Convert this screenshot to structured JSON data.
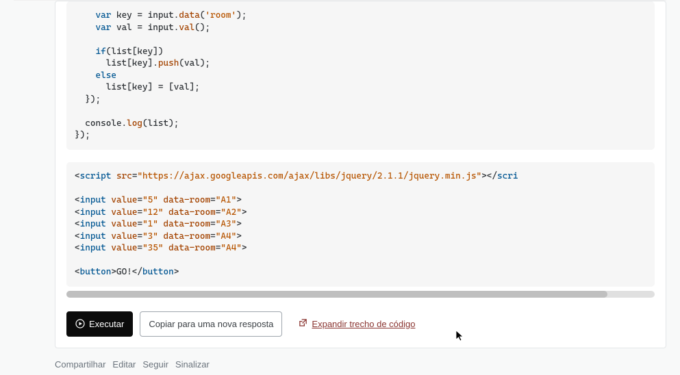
{
  "codeA": {
    "lines": [
      [
        {
          "c": "pun",
          "t": "    "
        },
        {
          "c": "kw",
          "t": "var"
        },
        {
          "c": "pun",
          "t": " key = input."
        },
        {
          "c": "fn",
          "t": "data"
        },
        {
          "c": "pun",
          "t": "("
        },
        {
          "c": "str",
          "t": "'room'"
        },
        {
          "c": "pun",
          "t": ");"
        }
      ],
      [
        {
          "c": "pun",
          "t": "    "
        },
        {
          "c": "kw",
          "t": "var"
        },
        {
          "c": "pun",
          "t": " val = input."
        },
        {
          "c": "fn",
          "t": "val"
        },
        {
          "c": "pun",
          "t": "();"
        }
      ],
      [],
      [
        {
          "c": "pun",
          "t": "    "
        },
        {
          "c": "kw",
          "t": "if"
        },
        {
          "c": "pun",
          "t": "(list[key])"
        }
      ],
      [
        {
          "c": "pun",
          "t": "      list[key]."
        },
        {
          "c": "fn",
          "t": "push"
        },
        {
          "c": "pun",
          "t": "(val);"
        }
      ],
      [
        {
          "c": "pun",
          "t": "    "
        },
        {
          "c": "kw",
          "t": "else"
        }
      ],
      [
        {
          "c": "pun",
          "t": "      list[key] = [val];"
        }
      ],
      [
        {
          "c": "pun",
          "t": "  });"
        }
      ],
      [],
      [
        {
          "c": "pun",
          "t": "  console."
        },
        {
          "c": "fn",
          "t": "log"
        },
        {
          "c": "pun",
          "t": "(list);"
        }
      ],
      [
        {
          "c": "pun",
          "t": "});"
        }
      ]
    ]
  },
  "codeB": {
    "lines": [
      [
        {
          "c": "pun",
          "t": "<"
        },
        {
          "c": "kw",
          "t": "script"
        },
        {
          "c": "pun",
          "t": " "
        },
        {
          "c": "fn",
          "t": "src"
        },
        {
          "c": "pun",
          "t": "="
        },
        {
          "c": "str",
          "t": "\"https://ajax.googleapis.com/ajax/libs/jquery/2.1.1/jquery.min.js\""
        },
        {
          "c": "pun",
          "t": "></"
        },
        {
          "c": "kw",
          "t": "scri"
        }
      ],
      [],
      [
        {
          "c": "pun",
          "t": "<"
        },
        {
          "c": "kw",
          "t": "input"
        },
        {
          "c": "pun",
          "t": " "
        },
        {
          "c": "fn",
          "t": "value"
        },
        {
          "c": "pun",
          "t": "="
        },
        {
          "c": "str",
          "t": "\"5\""
        },
        {
          "c": "pun",
          "t": " "
        },
        {
          "c": "fn",
          "t": "data-room"
        },
        {
          "c": "pun",
          "t": "="
        },
        {
          "c": "str",
          "t": "\"A1\""
        },
        {
          "c": "pun",
          "t": ">"
        }
      ],
      [
        {
          "c": "pun",
          "t": "<"
        },
        {
          "c": "kw",
          "t": "input"
        },
        {
          "c": "pun",
          "t": " "
        },
        {
          "c": "fn",
          "t": "value"
        },
        {
          "c": "pun",
          "t": "="
        },
        {
          "c": "str",
          "t": "\"12\""
        },
        {
          "c": "pun",
          "t": " "
        },
        {
          "c": "fn",
          "t": "data-room"
        },
        {
          "c": "pun",
          "t": "="
        },
        {
          "c": "str",
          "t": "\"A2\""
        },
        {
          "c": "pun",
          "t": ">"
        }
      ],
      [
        {
          "c": "pun",
          "t": "<"
        },
        {
          "c": "kw",
          "t": "input"
        },
        {
          "c": "pun",
          "t": " "
        },
        {
          "c": "fn",
          "t": "value"
        },
        {
          "c": "pun",
          "t": "="
        },
        {
          "c": "str",
          "t": "\"1\""
        },
        {
          "c": "pun",
          "t": " "
        },
        {
          "c": "fn",
          "t": "data-room"
        },
        {
          "c": "pun",
          "t": "="
        },
        {
          "c": "str",
          "t": "\"A3\""
        },
        {
          "c": "pun",
          "t": ">"
        }
      ],
      [
        {
          "c": "pun",
          "t": "<"
        },
        {
          "c": "kw",
          "t": "input"
        },
        {
          "c": "pun",
          "t": " "
        },
        {
          "c": "fn",
          "t": "value"
        },
        {
          "c": "pun",
          "t": "="
        },
        {
          "c": "str",
          "t": "\"3\""
        },
        {
          "c": "pun",
          "t": " "
        },
        {
          "c": "fn",
          "t": "data-room"
        },
        {
          "c": "pun",
          "t": "="
        },
        {
          "c": "str",
          "t": "\"A4\""
        },
        {
          "c": "pun",
          "t": ">"
        }
      ],
      [
        {
          "c": "pun",
          "t": "<"
        },
        {
          "c": "kw",
          "t": "input"
        },
        {
          "c": "pun",
          "t": " "
        },
        {
          "c": "fn",
          "t": "value"
        },
        {
          "c": "pun",
          "t": "="
        },
        {
          "c": "str",
          "t": "\"35\""
        },
        {
          "c": "pun",
          "t": " "
        },
        {
          "c": "fn",
          "t": "data-room"
        },
        {
          "c": "pun",
          "t": "="
        },
        {
          "c": "str",
          "t": "\"A4\""
        },
        {
          "c": "pun",
          "t": ">"
        }
      ],
      [],
      [
        {
          "c": "pun",
          "t": "<"
        },
        {
          "c": "kw",
          "t": "button"
        },
        {
          "c": "pun",
          "t": ">GO!</"
        },
        {
          "c": "kw",
          "t": "button"
        },
        {
          "c": "pun",
          "t": ">"
        }
      ]
    ]
  },
  "actions": {
    "run": "Executar",
    "copy": "Copiar para uma nova resposta",
    "expand": "Expandir trecho de código"
  },
  "footer": {
    "share": "Compartilhar",
    "edit": "Editar",
    "follow": "Seguir",
    "flag": "Sinalizar"
  }
}
